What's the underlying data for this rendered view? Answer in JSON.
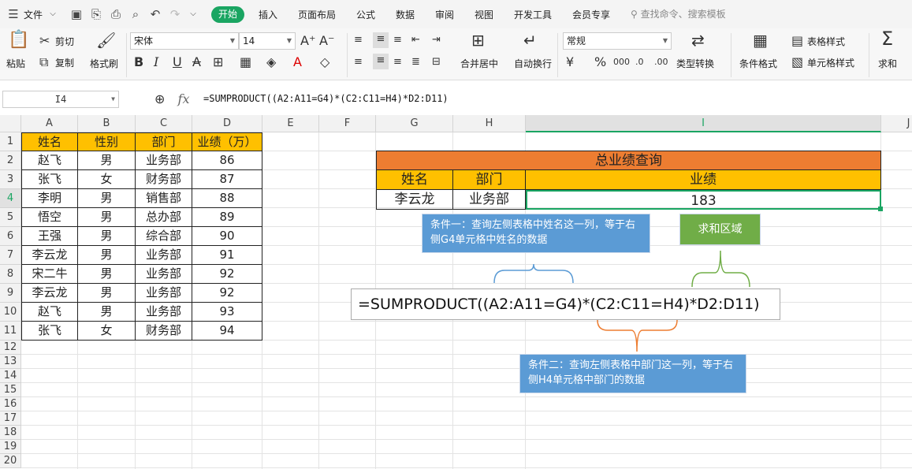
{
  "menu": {
    "file_label": "文件",
    "tabs": [
      "开始",
      "插入",
      "页面布局",
      "公式",
      "数据",
      "审阅",
      "视图",
      "开发工具",
      "会员专享"
    ],
    "search_placeholder": "查找命令、搜索模板"
  },
  "ribbon": {
    "paste": "粘贴",
    "cut": "剪切",
    "copy": "复制",
    "format_painter": "格式刷",
    "font_name": "宋体",
    "font_size": "14",
    "merge_center": "合并居中",
    "auto_wrap": "自动换行",
    "number_format": "常规",
    "type_convert": "类型转换",
    "conditional_format": "条件格式",
    "table_style": "表格样式",
    "cell_style": "单元格样式",
    "sum": "求和"
  },
  "formula_bar": {
    "cell_ref": "I4",
    "fx": "fx",
    "formula": "=SUMPRODUCT((A2:A11=G4)*(C2:C11=H4)*D2:D11)"
  },
  "columns": [
    "A",
    "B",
    "C",
    "D",
    "E",
    "F",
    "G",
    "H",
    "I",
    "J"
  ],
  "rows": [
    "1",
    "2",
    "3",
    "4",
    "5",
    "6",
    "7",
    "8",
    "9",
    "10",
    "11",
    "12",
    "13",
    "14",
    "15",
    "16",
    "17",
    "18",
    "19",
    "20"
  ],
  "table": {
    "headers": [
      "姓名",
      "性别",
      "部门",
      "业绩（万）"
    ],
    "rows": [
      [
        "赵飞",
        "男",
        "业务部",
        "86"
      ],
      [
        "张飞",
        "女",
        "财务部",
        "87"
      ],
      [
        "李明",
        "男",
        "销售部",
        "88"
      ],
      [
        "悟空",
        "男",
        "总办部",
        "89"
      ],
      [
        "王强",
        "男",
        "综合部",
        "90"
      ],
      [
        "李云龙",
        "男",
        "业务部",
        "91"
      ],
      [
        "宋二牛",
        "男",
        "业务部",
        "92"
      ],
      [
        "李云龙",
        "男",
        "业务部",
        "92"
      ],
      [
        "赵飞",
        "男",
        "业务部",
        "93"
      ],
      [
        "张飞",
        "女",
        "财务部",
        "94"
      ]
    ]
  },
  "lookup": {
    "title": "总业绩查询",
    "headers": [
      "姓名",
      "部门",
      "业绩"
    ],
    "values": [
      "李云龙",
      "业务部",
      "183"
    ]
  },
  "annotations": {
    "condition1": "条件一：查询左侧表格中姓名这一列，等于右侧G4单元格中姓名的数据",
    "sum_range": "求和区域",
    "formula": "=SUMPRODUCT((A2:A11=G4)*(C2:C11=H4)*D2:D11)",
    "condition2": "条件二：查询左侧表格中部门这一列，等于右侧H4单元格中部门的数据"
  },
  "colors": {
    "accent_green": "#1aa562",
    "title_orange": "#ed7d31",
    "header_gold": "#ffc000",
    "callout_blue": "#5b9bd5",
    "sum_green": "#70ad47"
  }
}
